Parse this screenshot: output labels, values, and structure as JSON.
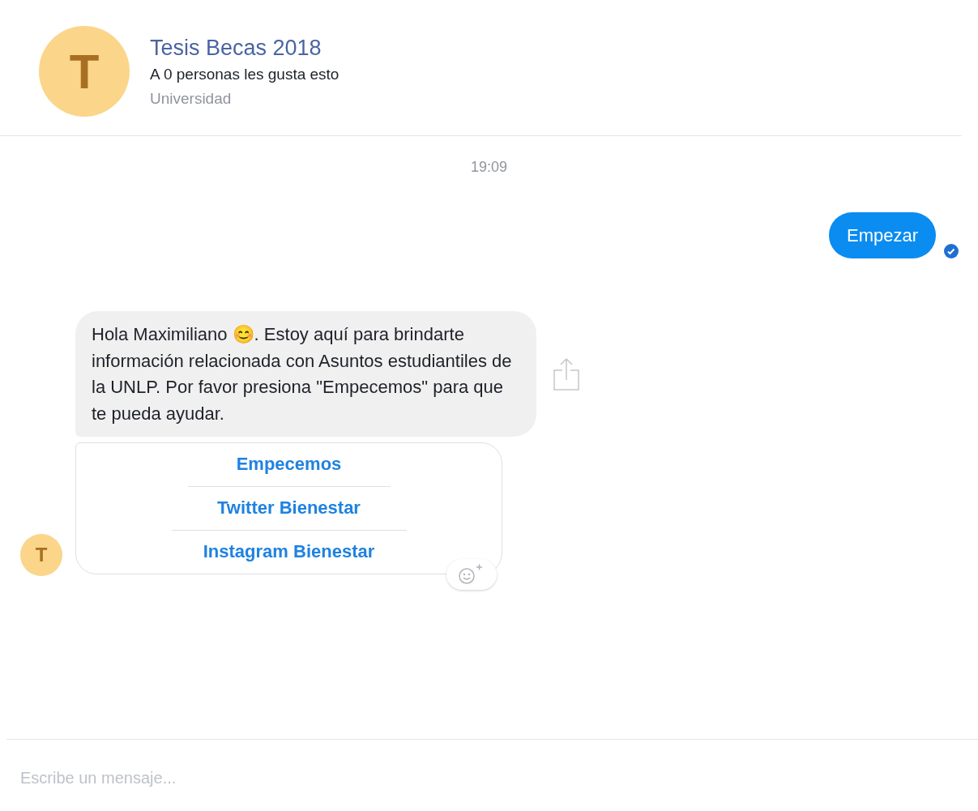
{
  "page": {
    "avatar_letter": "T",
    "name": "Tesis Becas 2018",
    "likes": "A 0 personas les gusta esto",
    "category": "Universidad"
  },
  "timestamp": "19:09",
  "messages": [
    {
      "kind": "sent",
      "text": "Empezar"
    },
    {
      "kind": "received",
      "text": "Hola Maximiliano 😊. Estoy aquí para brindarte información relacionada con Asuntos estudiantiles de la UNLP. Por favor presiona \"Empecemos\" para que te pueda ayudar.",
      "avatar_letter": "T",
      "quick_replies": [
        "Empecemos",
        "Twitter Bienestar",
        "Instagram Bienestar"
      ]
    }
  ],
  "composer": {
    "placeholder": "Escribe un mensaje..."
  }
}
